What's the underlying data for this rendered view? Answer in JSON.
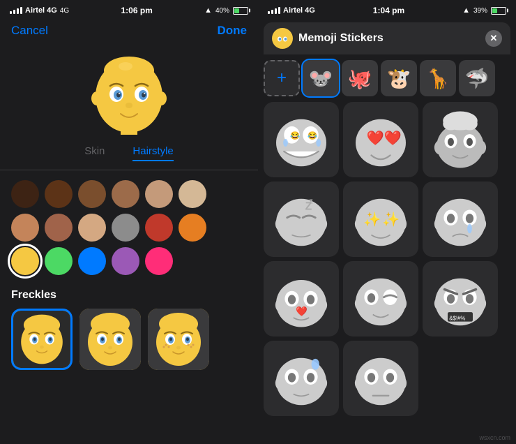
{
  "left_panel": {
    "status": {
      "carrier": "Airtel 4G",
      "time": "1:06 pm",
      "battery_pct": "40%"
    },
    "nav": {
      "cancel": "Cancel",
      "done": "Done"
    },
    "tabs": [
      {
        "id": "skin",
        "label": "Skin",
        "active": false
      },
      {
        "id": "hairstyle",
        "label": "Hairstyle",
        "active": true
      }
    ],
    "colors_row1": [
      "#3d2314",
      "#5c3317",
      "#7a4e2d",
      "#9c6b4a",
      "#c49a7a",
      "#d4b896"
    ],
    "colors_row2": [
      "#c4845a",
      "#a0634a",
      "#d4a882",
      "#8c8c8c",
      "#c0392b",
      "#e67e22"
    ],
    "colors_row3_selected": "#f5c842",
    "colors_row3": [
      "#f5c842",
      "#4cd964",
      "#007aff",
      "#9b59b6",
      "#ff2d78"
    ],
    "freckles": {
      "title": "Freckles",
      "options": [
        {
          "id": 0,
          "selected": true,
          "has_freckles": false
        },
        {
          "id": 1,
          "selected": false,
          "has_freckles": false
        },
        {
          "id": 2,
          "selected": false,
          "has_freckles": true
        }
      ]
    }
  },
  "right_panel": {
    "status": {
      "carrier": "Airtel 4G",
      "time": "1:04 pm",
      "battery_pct": "39%"
    },
    "header": {
      "title": "Memoji Stickers",
      "close_label": "✕"
    },
    "top_stickers": [
      {
        "id": "add",
        "type": "add",
        "icon": "+"
      },
      {
        "id": "mouse1",
        "type": "emoji",
        "icon": "🐭",
        "selected": true
      },
      {
        "id": "octopus",
        "type": "emoji",
        "icon": "🐙"
      },
      {
        "id": "cow",
        "type": "emoji",
        "icon": "🐮"
      },
      {
        "id": "giraffe",
        "type": "emoji",
        "icon": "🦒"
      },
      {
        "id": "shark",
        "type": "emoji",
        "icon": "🦈"
      }
    ],
    "sticker_rows": [
      [
        "😂",
        "😍",
        "🥰"
      ],
      [
        "😴",
        "🤩",
        "😢"
      ],
      [
        "❤️🐭",
        "😒",
        "🤬"
      ],
      [
        "😰",
        "😌"
      ]
    ]
  },
  "watermark": "wsxcn.com"
}
